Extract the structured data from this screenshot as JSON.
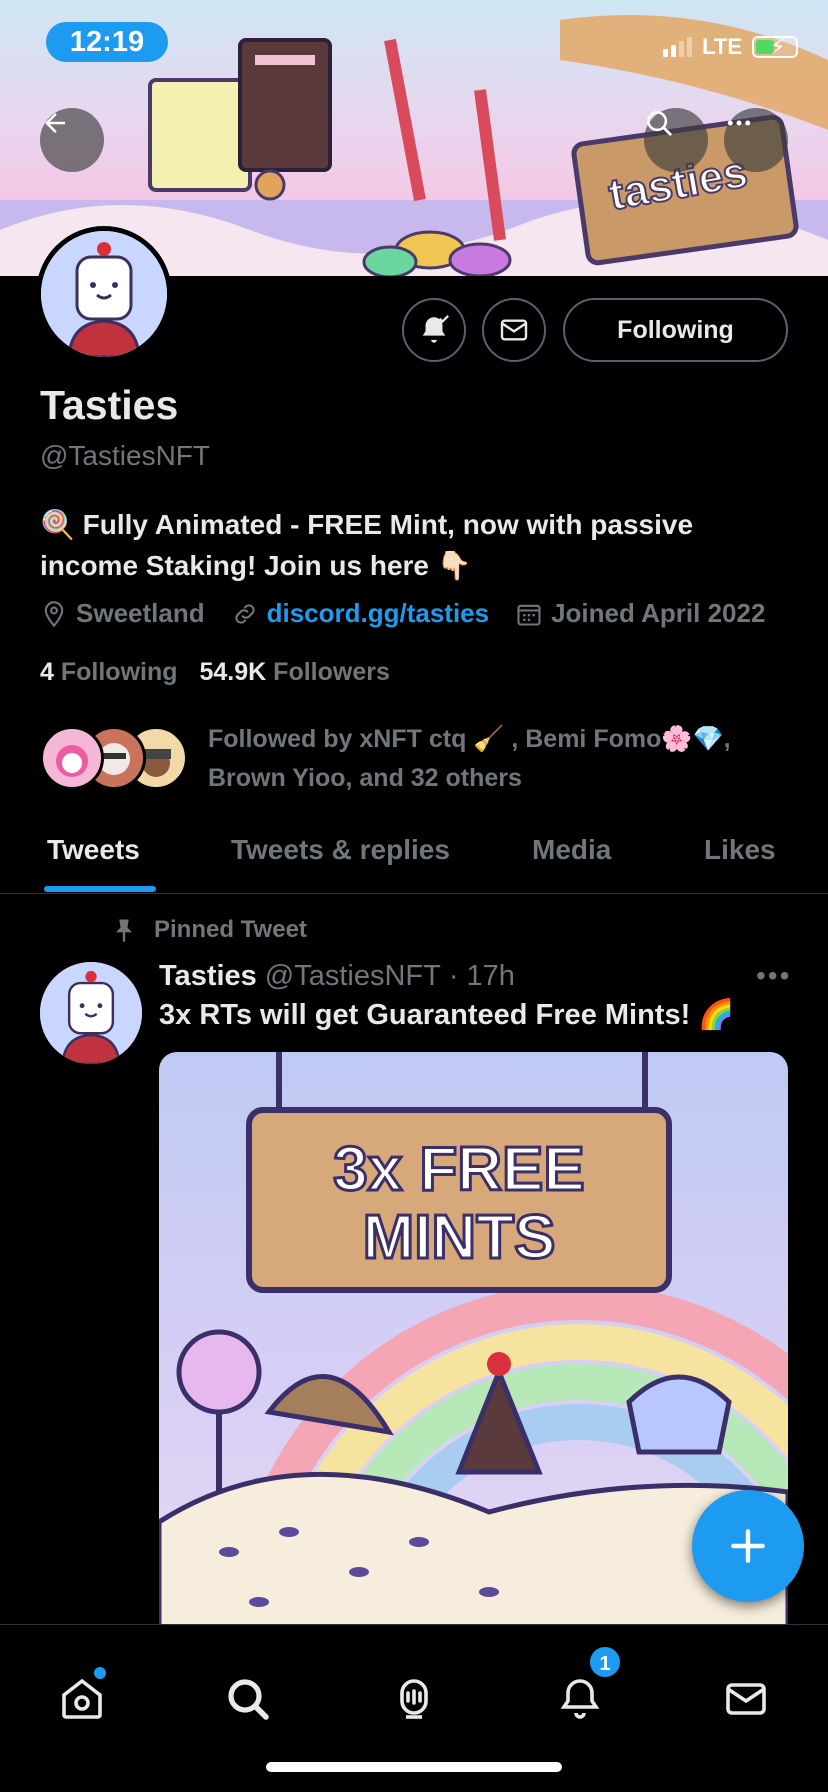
{
  "status_bar": {
    "time": "12:19",
    "network": "LTE"
  },
  "banner": {
    "sign_text": "tasties"
  },
  "profile": {
    "name": "Tasties",
    "handle": "@TastiesNFT",
    "bio_emoji": "🍭",
    "bio": "Fully Animated - FREE Mint, now with passive income Staking! Join us here",
    "bio_emoji_end": "👇🏻",
    "location": "Sweetland",
    "link": "discord.gg/tasties",
    "joined": "Joined April 2022",
    "following_count": "4",
    "following_label": "Following",
    "followers_count": "54.9K",
    "followers_label": "Followers",
    "followed_by": "Followed by xNFT ctq 🧹 , Bemi Fomo🌸💎, Brown Yioo, and 32 others",
    "following_button": "Following"
  },
  "tabs": [
    "Tweets",
    "Tweets & replies",
    "Media",
    "Likes"
  ],
  "pinned_tweet": {
    "pinned_label": "Pinned Tweet",
    "author": "Tasties",
    "handle": "@TastiesNFT",
    "separator": "·",
    "time": "17h",
    "text": "3x RTs will get Guaranteed Free Mints! 🌈",
    "image_text_line1": "3x FREE",
    "image_text_line2": "MINTS"
  },
  "bottom_nav": {
    "notifications_badge": "1"
  },
  "colors": {
    "accent": "#1d9bf0",
    "background": "#000000",
    "muted": "#71767b"
  }
}
